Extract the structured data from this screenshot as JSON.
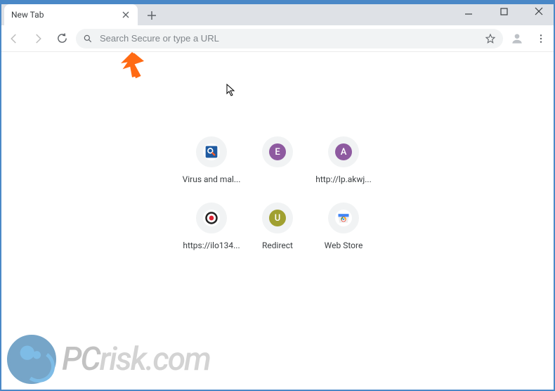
{
  "tab": {
    "title": "New Tab"
  },
  "omnibox": {
    "placeholder": "Search Secure or type a URL"
  },
  "shortcuts": [
    {
      "label": "Virus and mal...",
      "icon": "search-shield",
      "bg": "#ffffff",
      "accent": "#f15a29"
    },
    {
      "label": "",
      "icon": "letter",
      "bg": "#8e5aa0",
      "letter": "E",
      "fg": "#ffffff"
    },
    {
      "label": "http://lp.akwj...",
      "icon": "letter",
      "bg": "#8e5aa0",
      "letter": "A",
      "fg": "#ffffff"
    },
    {
      "label": "https://ilo134...",
      "icon": "target",
      "bg": "#ffffff"
    },
    {
      "label": "Redirect",
      "icon": "letter",
      "bg": "#a0a030",
      "letter": "U",
      "fg": "#ffffff"
    },
    {
      "label": "Web Store",
      "icon": "webstore",
      "bg": "#ffffff"
    }
  ],
  "watermark": {
    "text_pc": "PC",
    "text_rest": "risk.com"
  },
  "colors": {
    "frame": "#4a88c7",
    "arrow": "#ff6a13"
  }
}
